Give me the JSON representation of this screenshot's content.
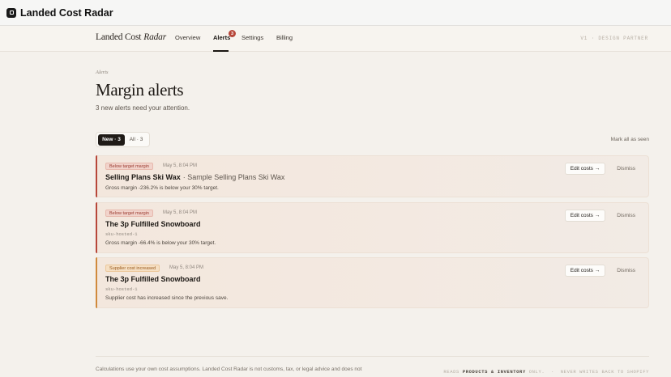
{
  "app": {
    "title": "Landed Cost Radar"
  },
  "nav": {
    "brand_a": "Landed Cost",
    "brand_b": "Radar",
    "items": [
      "Overview",
      "Alerts",
      "Settings",
      "Billing"
    ],
    "active": "Alerts",
    "alerts_badge": "3",
    "partner": "V1 · DESIGN PARTNER"
  },
  "header": {
    "breadcrumb": "Alerts",
    "title": "Margin alerts",
    "subtitle": "3 new alerts need your attention."
  },
  "filters": {
    "new_label": "New · 3",
    "all_label": "All · 3",
    "selected": "New · 3",
    "mark_all": "Mark all as seen"
  },
  "alerts": [
    {
      "badge": "Below target margin",
      "timestamp": "May 5, 8:04 PM",
      "title": "Selling Plans Ski Wax",
      "variant": "· Sample Selling Plans Ski Wax",
      "sku": "",
      "description": "Gross margin -236.2% is below your 30% target.",
      "edit_label": "Edit costs →",
      "dismiss_label": "Dismiss",
      "accent": "#b7473a"
    },
    {
      "badge": "Below target margin",
      "timestamp": "May 5, 8:04 PM",
      "title": "The 3p Fulfilled Snowboard",
      "variant": "",
      "sku": "sku-hosted-1",
      "description": "Gross margin -66.4% is below your 30% target.",
      "edit_label": "Edit costs →",
      "dismiss_label": "Dismiss",
      "accent": "#b7473a"
    },
    {
      "badge": "Supplier cost increased",
      "timestamp": "May 5, 8:04 PM",
      "title": "The 3p Fulfilled Snowboard",
      "variant": "",
      "sku": "sku-hosted-1",
      "description": "Supplier cost has increased since the previous save.",
      "edit_label": "Edit costs →",
      "dismiss_label": "Dismiss",
      "accent": "#d08a3c"
    }
  ],
  "footer": {
    "disclaimer": "Calculations use your own cost assumptions. Landed Cost Radar is not customs, tax, or legal advice and does not",
    "reads_prefix": "READS",
    "reads_scope": "PRODUCTS & INVENTORY",
    "reads_mode": "ONLY.",
    "writes": "NEVER WRITES BACK TO SHOPIFY"
  }
}
